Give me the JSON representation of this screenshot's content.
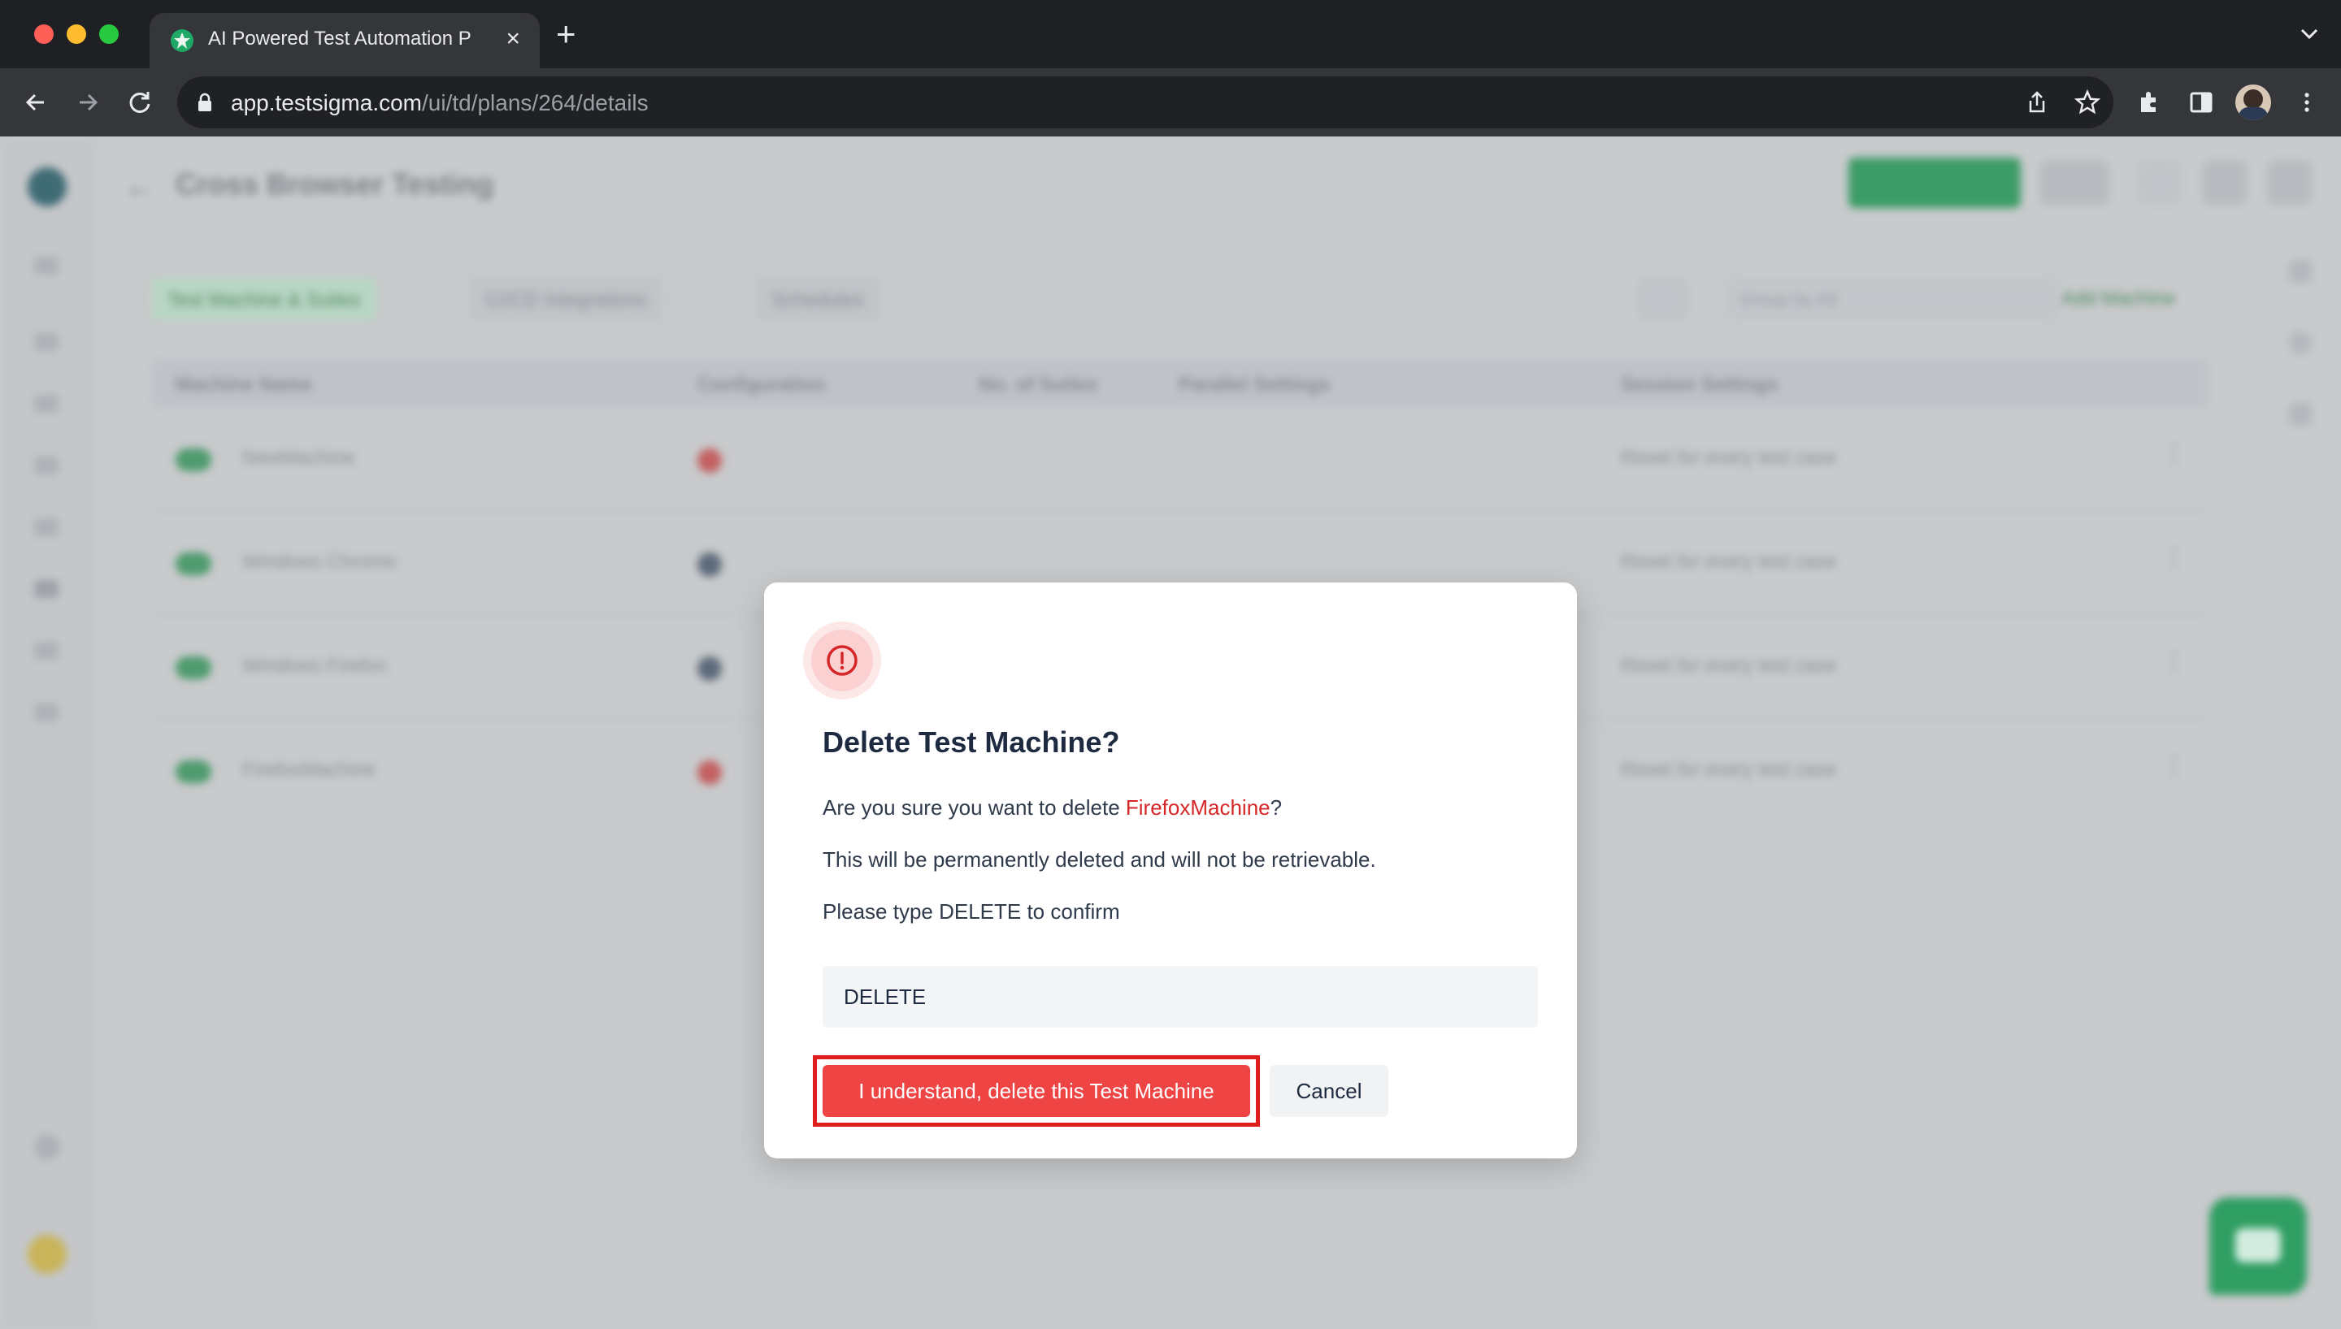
{
  "browser": {
    "tab_title": "AI Powered Test Automation P",
    "url_domain": "app.testsigma.com",
    "url_path": "/ui/td/plans/264/details"
  },
  "page": {
    "title": "Cross Browser Testing",
    "tabs": [
      {
        "label": "Test Machine & Suites"
      },
      {
        "label": "CI/CD Integrations"
      },
      {
        "label": "Schedules"
      }
    ],
    "search_placeholder": "Group by All",
    "add_machine_label": "Add Machine",
    "table": {
      "headers": [
        "Machine Name",
        "Configuration",
        "No. of Suites",
        "Parallel Settings",
        "Session Settings"
      ],
      "rows": [
        {
          "name": "NewMachine",
          "session": "Reset for every test case"
        },
        {
          "name": "Windows Chrome",
          "session": "Reset for every test case"
        },
        {
          "name": "Windows Firefox",
          "session": "Reset for every test case"
        },
        {
          "name": "FirefoxMachine",
          "session": "Reset for every test case"
        }
      ]
    }
  },
  "modal": {
    "title": "Delete Test Machine?",
    "question_prefix": "Are you sure you want to delete ",
    "machine_name": "FirefoxMachine",
    "question_suffix": "?",
    "warning": "This will be permanently deleted and will not be retrievable.",
    "instruction": "Please type DELETE to confirm",
    "input_value": "DELETE",
    "delete_label": "I understand, delete this Test Machine",
    "cancel_label": "Cancel"
  },
  "colors": {
    "danger": "#ee4444",
    "highlight_outline": "#e01e1e",
    "brand_green": "#2f9e62"
  }
}
